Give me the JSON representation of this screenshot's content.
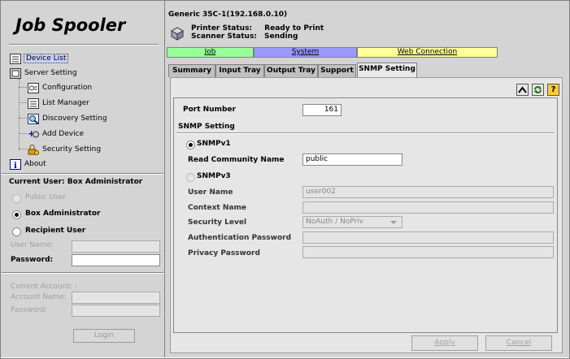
{
  "app_title": "Job Spooler",
  "tree": [
    {
      "label": "Device List",
      "icon": "device-list-icon"
    },
    {
      "label": "Server Setting",
      "icon": "server-icon"
    },
    {
      "label": "Configuration",
      "icon": "configuration-icon"
    },
    {
      "label": "List Manager",
      "icon": "list-manager-icon"
    },
    {
      "label": "Discovery Setting",
      "icon": "discovery-icon"
    },
    {
      "label": "Add Device",
      "icon": "add-device-icon"
    },
    {
      "label": "Security Setting",
      "icon": "security-icon"
    },
    {
      "label": "About",
      "icon": "info-icon"
    }
  ],
  "user": {
    "current_user": "Current User: Box Administrator",
    "options": [
      "Public User",
      "Box Administrator",
      "Recipient User"
    ],
    "selected": "Box Administrator",
    "user_name_label": "User Name:",
    "password_label": "Password:",
    "current_account": "Current Account: -",
    "account_name_label": "Account Name:",
    "account_password_label": "Password:",
    "login_label": "Login"
  },
  "device": {
    "title": "Generic 35C-1(192.168.0.10)",
    "printer_status_label": "Printer Status:",
    "printer_status": "Ready to Print",
    "scanner_status_label": "Scanner Status:",
    "scanner_status": "Sending"
  },
  "main_tabs": [
    {
      "label": "Job",
      "color": "#99ff99"
    },
    {
      "label": "System",
      "color": "#9999ff"
    },
    {
      "label": "Web Connection",
      "color": "#ffff99"
    }
  ],
  "sub_tabs": [
    "Summary",
    "Input Tray",
    "Output Tray",
    "Support",
    "SNMP Setting"
  ],
  "active_sub_tab": "SNMP Setting",
  "snmp": {
    "port_label": "Port Number",
    "port_value": "161",
    "section_label": "SNMP Setting",
    "v1_label": "SNMPv1",
    "read_community_label": "Read Community Name",
    "read_community_value": "public",
    "v3_label": "SNMPv3",
    "user_name_label": "User Name",
    "user_name_value": "user002",
    "context_name_label": "Context Name",
    "context_name_value": "",
    "security_level_label": "Security Level",
    "security_level_value": "NoAuth / NoPriv",
    "auth_password_label": "Authentication Password",
    "priv_password_label": "Privacy Password"
  },
  "actions": {
    "apply": "Apply",
    "cancel": "Cancel"
  },
  "toolbar_icons": [
    "collapse-up-icon",
    "refresh-icon",
    "help-icon"
  ]
}
